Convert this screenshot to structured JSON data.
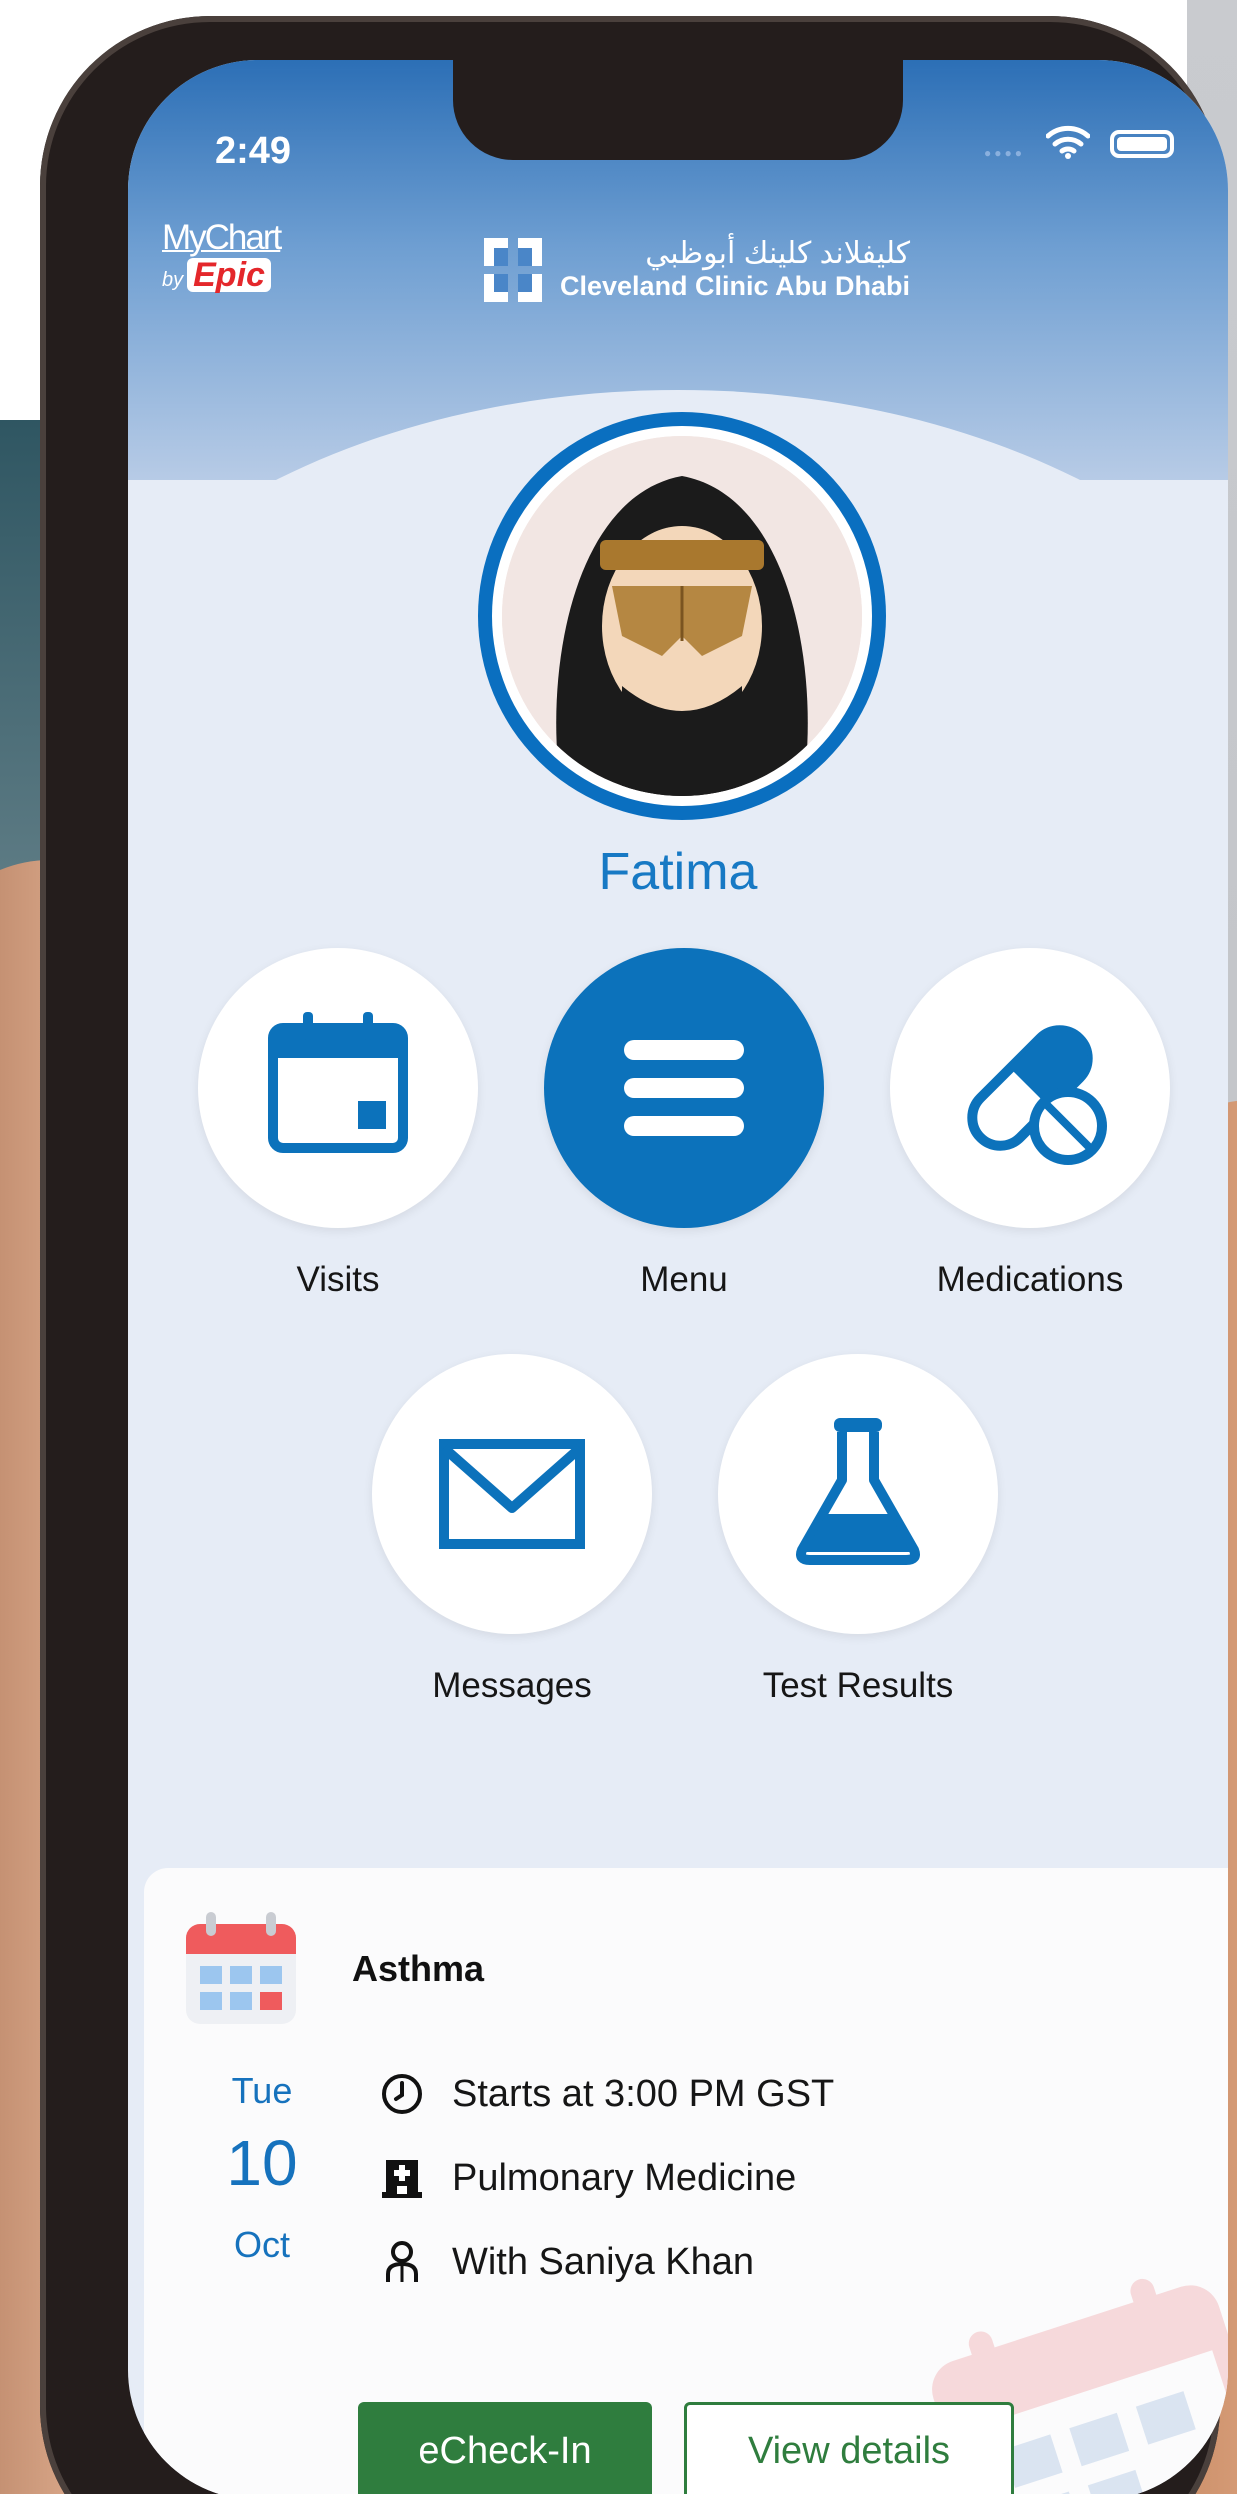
{
  "status_bar": {
    "time": "2:49"
  },
  "branding": {
    "mychart_name": "MyChart",
    "mychart_by": "by",
    "mychart_epic": "Epic",
    "clinic_arabic": "كليفلاند كلينك أبوظبي",
    "clinic_english": "Cleveland Clinic Abu Dhabi"
  },
  "profile": {
    "name": "Fatima"
  },
  "shortcuts": [
    {
      "label": "Visits",
      "icon": "calendar-icon"
    },
    {
      "label": "Menu",
      "icon": "hamburger-menu-icon"
    },
    {
      "label": "Medications",
      "icon": "pills-icon"
    },
    {
      "label": "Messages",
      "icon": "envelope-icon"
    },
    {
      "label": "Test Results",
      "icon": "flask-icon"
    }
  ],
  "appointment": {
    "title": "Asthma",
    "day_of_week": "Tue",
    "day": "10",
    "month": "Oct",
    "time": "Starts at 3:00 PM GST",
    "department": "Pulmonary Medicine",
    "provider": "With Saniya Khan",
    "checkin_label": "eCheck-In",
    "details_label": "View details"
  },
  "colors": {
    "brand_blue": "#0c72bb",
    "link_blue": "#1672bd",
    "button_green": "#2f7d3e",
    "epic_red": "#e4272b"
  }
}
